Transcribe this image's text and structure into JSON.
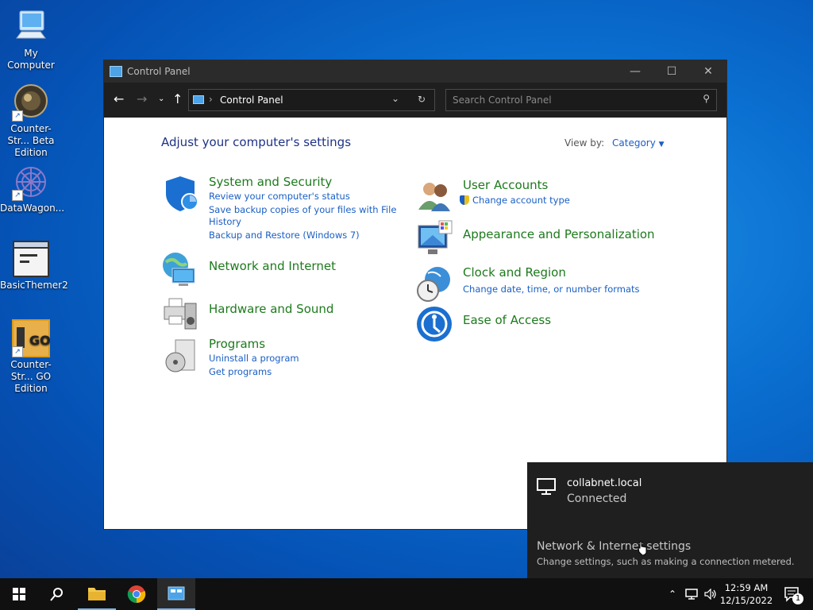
{
  "desktop": {
    "icons": [
      {
        "label": "My Computer"
      },
      {
        "label": "Counter-Str... Beta Edition"
      },
      {
        "label": "DataWagon..."
      },
      {
        "label": "BasicThemer2"
      },
      {
        "label": "Counter-Str... GO Edition"
      }
    ]
  },
  "window": {
    "title": "Control Panel",
    "address": "Control Panel",
    "search_placeholder": "Search Control Panel",
    "heading": "Adjust your computer's settings",
    "view_by_label": "View by:",
    "view_by_value": "Category",
    "categories_left": [
      {
        "title": "System and Security",
        "links": [
          "Review your computer's status",
          "Save backup copies of your files with File",
          "History",
          "Backup and Restore (Windows 7)"
        ]
      },
      {
        "title": "Network and Internet",
        "links": []
      },
      {
        "title": "Hardware and Sound",
        "links": []
      },
      {
        "title": "Programs",
        "links": [
          "Uninstall a program",
          "Get programs"
        ]
      }
    ],
    "categories_right": [
      {
        "title": "User Accounts",
        "links": [
          "Change account type"
        ]
      },
      {
        "title": "Appearance and Personalization",
        "links": []
      },
      {
        "title": "Clock and Region",
        "links": [
          "Change date, time, or number formats"
        ]
      },
      {
        "title": "Ease of Access",
        "links": []
      }
    ]
  },
  "flyout": {
    "network_name": "collabnet.local",
    "network_status": "Connected",
    "settings_title": "Network & Internet settings",
    "settings_desc": "Change settings, such as making a connection metered."
  },
  "taskbar": {
    "time": "12:59 AM",
    "date": "12/15/2022",
    "notification_count": "1"
  },
  "colors": {
    "accent": "#1a5fc5",
    "category_green": "#1d7a1d",
    "heading_blue": "#1e3287"
  }
}
